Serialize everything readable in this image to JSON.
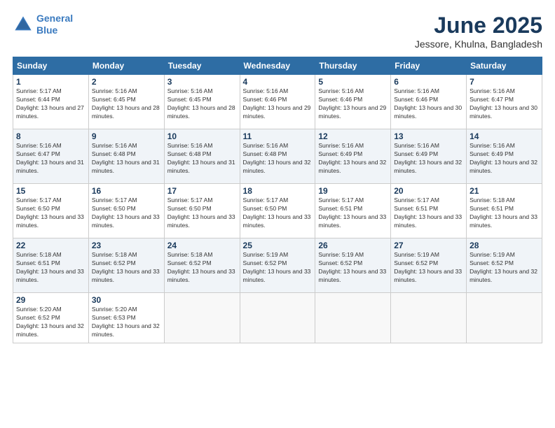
{
  "logo": {
    "line1": "General",
    "line2": "Blue"
  },
  "title": "June 2025",
  "subtitle": "Jessore, Khulna, Bangladesh",
  "weekdays": [
    "Sunday",
    "Monday",
    "Tuesday",
    "Wednesday",
    "Thursday",
    "Friday",
    "Saturday"
  ],
  "weeks": [
    [
      {
        "day": "1",
        "sunrise": "5:17 AM",
        "sunset": "6:44 PM",
        "daylight": "13 hours and 27 minutes."
      },
      {
        "day": "2",
        "sunrise": "5:16 AM",
        "sunset": "6:45 PM",
        "daylight": "13 hours and 28 minutes."
      },
      {
        "day": "3",
        "sunrise": "5:16 AM",
        "sunset": "6:45 PM",
        "daylight": "13 hours and 28 minutes."
      },
      {
        "day": "4",
        "sunrise": "5:16 AM",
        "sunset": "6:46 PM",
        "daylight": "13 hours and 29 minutes."
      },
      {
        "day": "5",
        "sunrise": "5:16 AM",
        "sunset": "6:46 PM",
        "daylight": "13 hours and 29 minutes."
      },
      {
        "day": "6",
        "sunrise": "5:16 AM",
        "sunset": "6:46 PM",
        "daylight": "13 hours and 30 minutes."
      },
      {
        "day": "7",
        "sunrise": "5:16 AM",
        "sunset": "6:47 PM",
        "daylight": "13 hours and 30 minutes."
      }
    ],
    [
      {
        "day": "8",
        "sunrise": "5:16 AM",
        "sunset": "6:47 PM",
        "daylight": "13 hours and 31 minutes."
      },
      {
        "day": "9",
        "sunrise": "5:16 AM",
        "sunset": "6:48 PM",
        "daylight": "13 hours and 31 minutes."
      },
      {
        "day": "10",
        "sunrise": "5:16 AM",
        "sunset": "6:48 PM",
        "daylight": "13 hours and 31 minutes."
      },
      {
        "day": "11",
        "sunrise": "5:16 AM",
        "sunset": "6:48 PM",
        "daylight": "13 hours and 32 minutes."
      },
      {
        "day": "12",
        "sunrise": "5:16 AM",
        "sunset": "6:49 PM",
        "daylight": "13 hours and 32 minutes."
      },
      {
        "day": "13",
        "sunrise": "5:16 AM",
        "sunset": "6:49 PM",
        "daylight": "13 hours and 32 minutes."
      },
      {
        "day": "14",
        "sunrise": "5:16 AM",
        "sunset": "6:49 PM",
        "daylight": "13 hours and 32 minutes."
      }
    ],
    [
      {
        "day": "15",
        "sunrise": "5:17 AM",
        "sunset": "6:50 PM",
        "daylight": "13 hours and 33 minutes."
      },
      {
        "day": "16",
        "sunrise": "5:17 AM",
        "sunset": "6:50 PM",
        "daylight": "13 hours and 33 minutes."
      },
      {
        "day": "17",
        "sunrise": "5:17 AM",
        "sunset": "6:50 PM",
        "daylight": "13 hours and 33 minutes."
      },
      {
        "day": "18",
        "sunrise": "5:17 AM",
        "sunset": "6:50 PM",
        "daylight": "13 hours and 33 minutes."
      },
      {
        "day": "19",
        "sunrise": "5:17 AM",
        "sunset": "6:51 PM",
        "daylight": "13 hours and 33 minutes."
      },
      {
        "day": "20",
        "sunrise": "5:17 AM",
        "sunset": "6:51 PM",
        "daylight": "13 hours and 33 minutes."
      },
      {
        "day": "21",
        "sunrise": "5:18 AM",
        "sunset": "6:51 PM",
        "daylight": "13 hours and 33 minutes."
      }
    ],
    [
      {
        "day": "22",
        "sunrise": "5:18 AM",
        "sunset": "6:51 PM",
        "daylight": "13 hours and 33 minutes."
      },
      {
        "day": "23",
        "sunrise": "5:18 AM",
        "sunset": "6:52 PM",
        "daylight": "13 hours and 33 minutes."
      },
      {
        "day": "24",
        "sunrise": "5:18 AM",
        "sunset": "6:52 PM",
        "daylight": "13 hours and 33 minutes."
      },
      {
        "day": "25",
        "sunrise": "5:19 AM",
        "sunset": "6:52 PM",
        "daylight": "13 hours and 33 minutes."
      },
      {
        "day": "26",
        "sunrise": "5:19 AM",
        "sunset": "6:52 PM",
        "daylight": "13 hours and 33 minutes."
      },
      {
        "day": "27",
        "sunrise": "5:19 AM",
        "sunset": "6:52 PM",
        "daylight": "13 hours and 33 minutes."
      },
      {
        "day": "28",
        "sunrise": "5:19 AM",
        "sunset": "6:52 PM",
        "daylight": "13 hours and 32 minutes."
      }
    ],
    [
      {
        "day": "29",
        "sunrise": "5:20 AM",
        "sunset": "6:52 PM",
        "daylight": "13 hours and 32 minutes."
      },
      {
        "day": "30",
        "sunrise": "5:20 AM",
        "sunset": "6:53 PM",
        "daylight": "13 hours and 32 minutes."
      },
      null,
      null,
      null,
      null,
      null
    ]
  ]
}
